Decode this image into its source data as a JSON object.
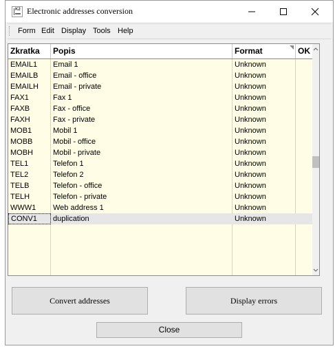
{
  "window": {
    "title": "Electronic addresses conversion",
    "icon": "app-icon"
  },
  "menu": {
    "items": [
      "Form",
      "Edit",
      "Display",
      "Tools",
      "Help"
    ]
  },
  "grid": {
    "columns": [
      "Zkratka",
      "Popis",
      "Format",
      "OK"
    ],
    "rows": [
      {
        "code": "EMAIL1",
        "desc": "Email 1",
        "format": "Unknown",
        "ok": ""
      },
      {
        "code": "EMAILB",
        "desc": "Email - office",
        "format": "Unknown",
        "ok": ""
      },
      {
        "code": "EMAILH",
        "desc": "Email - private",
        "format": "Unknown",
        "ok": ""
      },
      {
        "code": "FAX1",
        "desc": "Fax 1",
        "format": "Unknown",
        "ok": ""
      },
      {
        "code": "FAXB",
        "desc": "Fax - office",
        "format": "Unknown",
        "ok": ""
      },
      {
        "code": "FAXH",
        "desc": "Fax - private",
        "format": "Unknown",
        "ok": ""
      },
      {
        "code": "MOB1",
        "desc": "Mobil 1",
        "format": "Unknown",
        "ok": ""
      },
      {
        "code": "MOBB",
        "desc": "Mobil - office",
        "format": "Unknown",
        "ok": ""
      },
      {
        "code": "MOBH",
        "desc": "Mobil - private",
        "format": "Unknown",
        "ok": ""
      },
      {
        "code": "TEL1",
        "desc": "Telefon 1",
        "format": "Unknown",
        "ok": ""
      },
      {
        "code": "TEL2",
        "desc": "Telefon 2",
        "format": "Unknown",
        "ok": ""
      },
      {
        "code": "TELB",
        "desc": "Telefon - office",
        "format": "Unknown",
        "ok": ""
      },
      {
        "code": "TELH",
        "desc": "Telefon - private",
        "format": "Unknown",
        "ok": ""
      },
      {
        "code": "WWW1",
        "desc": "Web address 1",
        "format": "Unknown",
        "ok": ""
      },
      {
        "code": "CONV1",
        "desc": "duplication",
        "format": "Unknown",
        "ok": "",
        "selected": true
      }
    ]
  },
  "buttons": {
    "convert": "Convert addresses",
    "errors": "Display errors",
    "close": "Close"
  },
  "colors": {
    "grid_background": "#fffde6",
    "selected_row": "#e6e6e6"
  }
}
